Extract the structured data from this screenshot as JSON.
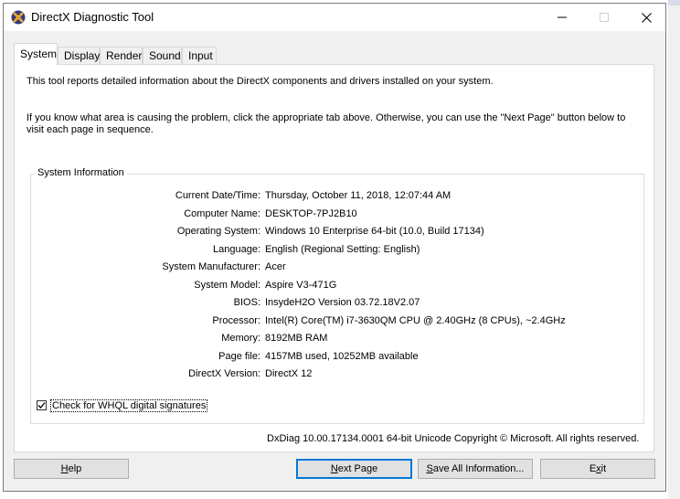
{
  "window": {
    "title": "DirectX Diagnostic Tool",
    "minimize": "–",
    "maximize": "☐",
    "close": "✕"
  },
  "tabs": [
    {
      "label": "System"
    },
    {
      "label": "Display"
    },
    {
      "label": "Render"
    },
    {
      "label": "Sound"
    },
    {
      "label": "Input"
    }
  ],
  "intro": {
    "line1": "This tool reports detailed information about the DirectX components and drivers installed on your system.",
    "line2": "If you know what area is causing the problem, click the appropriate tab above.  Otherwise, you can use the \"Next Page\" button below to visit each page in sequence."
  },
  "system_info": {
    "legend": "System Information",
    "rows": [
      {
        "label": "Current Date/Time:",
        "value": "Thursday, October 11, 2018, 12:07:44 AM"
      },
      {
        "label": "Computer Name:",
        "value": "DESKTOP-7PJ2B10"
      },
      {
        "label": "Operating System:",
        "value": "Windows 10 Enterprise 64-bit (10.0, Build 17134)"
      },
      {
        "label": "Language:",
        "value": "English (Regional Setting: English)"
      },
      {
        "label": "System Manufacturer:",
        "value": "Acer"
      },
      {
        "label": "System Model:",
        "value": "Aspire V3-471G"
      },
      {
        "label": "BIOS:",
        "value": "InsydeH2O Version 03.72.18V2.07"
      },
      {
        "label": "Processor:",
        "value": "Intel(R) Core(TM) i7-3630QM CPU @ 2.40GHz (8 CPUs), ~2.4GHz"
      },
      {
        "label": "Memory:",
        "value": "8192MB RAM"
      },
      {
        "label": "Page file:",
        "value": "4157MB used, 10252MB available"
      },
      {
        "label": "DirectX Version:",
        "value": "DirectX 12"
      }
    ]
  },
  "whql": {
    "label": "Check for WHQL digital signatures",
    "checked": true
  },
  "copyright": "DxDiag 10.00.17134.0001 64-bit Unicode  Copyright © Microsoft. All rights reserved.",
  "buttons": {
    "help": {
      "pre": "",
      "accel": "H",
      "post": "elp"
    },
    "next": {
      "pre": "",
      "accel": "N",
      "post": "ext Page"
    },
    "save": {
      "pre": "",
      "accel": "S",
      "post": "ave All Information..."
    },
    "exit": {
      "pre": "E",
      "accel": "x",
      "post": "it"
    }
  }
}
